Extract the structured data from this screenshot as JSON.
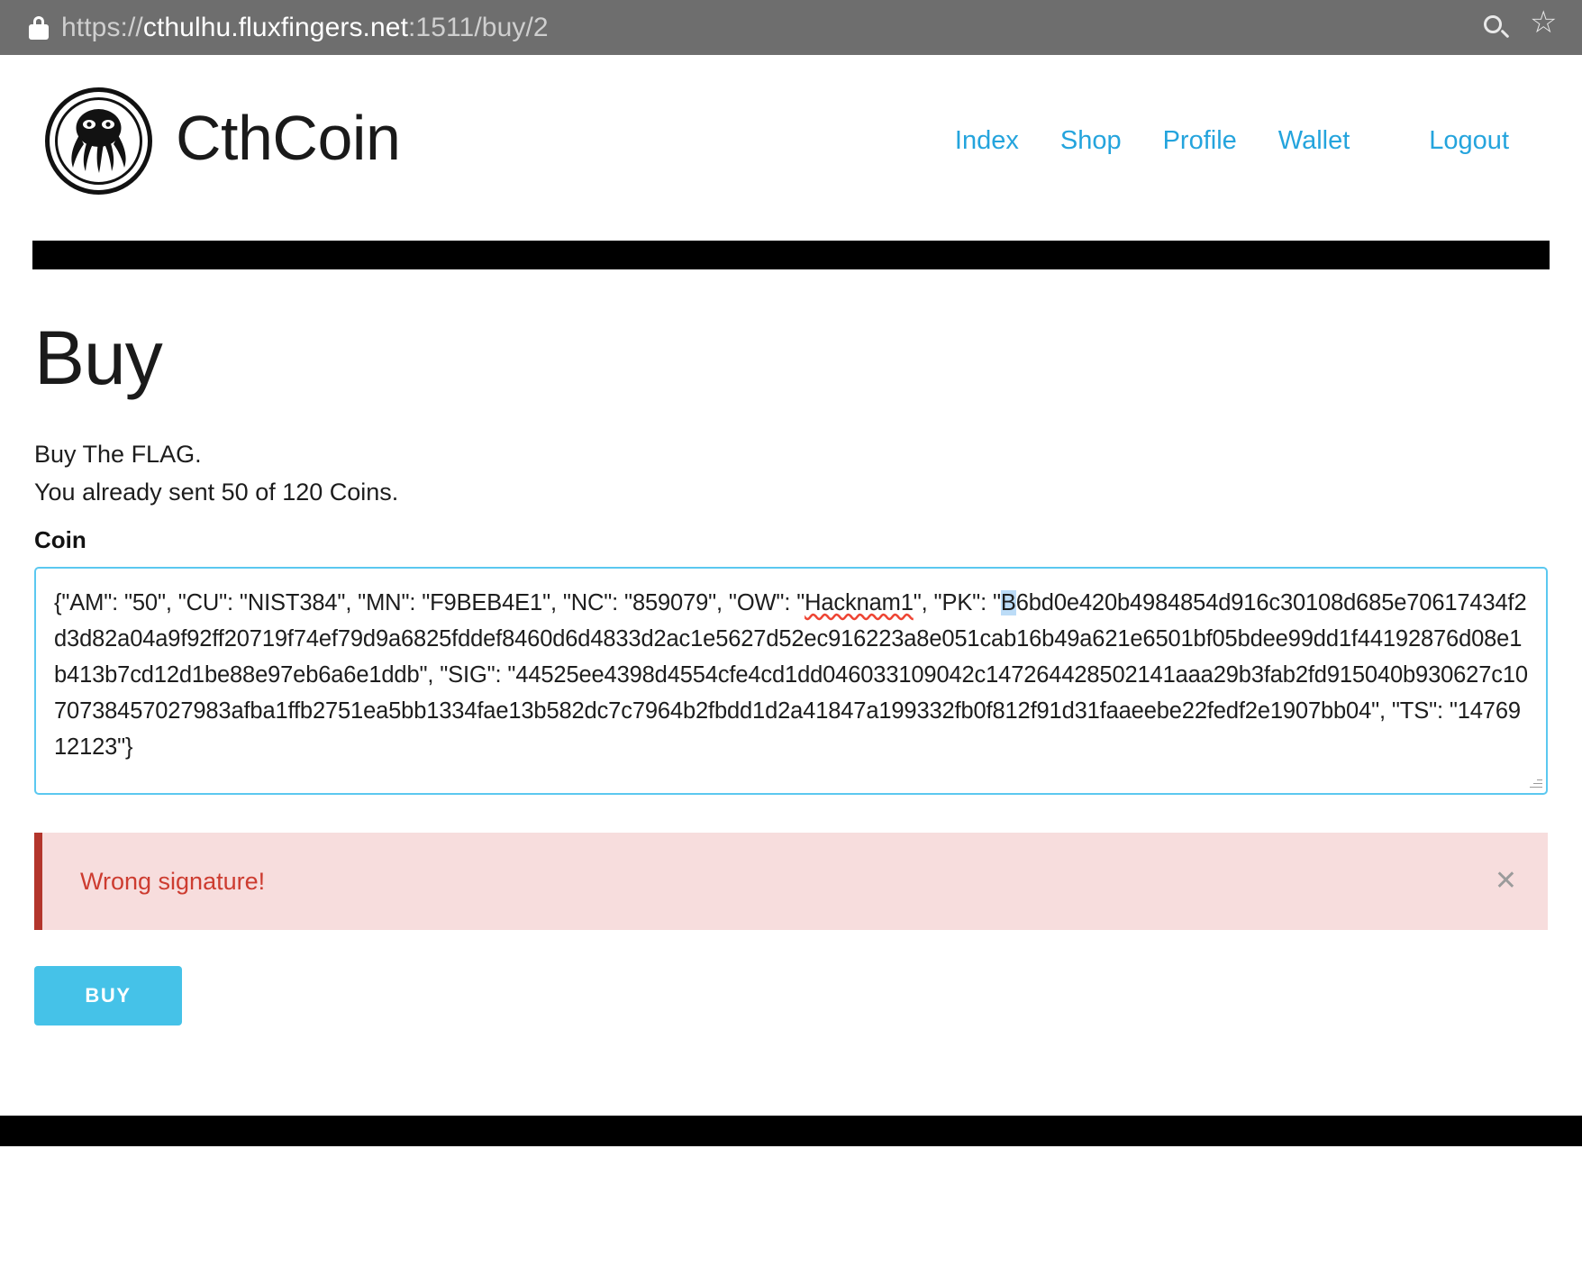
{
  "browser": {
    "lock_icon": "lock-icon",
    "url_prefix": "https://",
    "url_host": "cthulhu.fluxfingers.net",
    "url_suffix": ":1511/buy/2",
    "search_icon": "search-icon",
    "bookmark_icon": "star-icon"
  },
  "site": {
    "brand": "CthCoin",
    "logo_icon": "cthulhu-logo-icon",
    "nav": [
      {
        "label": "Index"
      },
      {
        "label": "Shop"
      },
      {
        "label": "Profile"
      },
      {
        "label": "Wallet"
      },
      {
        "label": "Logout"
      }
    ]
  },
  "main": {
    "title": "Buy",
    "description": "Buy The FLAG.",
    "status": "You already sent 50 of 120 Coins.",
    "field_label": "Coin",
    "coin_value_part1": "{\"AM\": \"50\", \"CU\": \"NIST384\", \"MN\": \"F9BEB4E1\", \"NC\": \"859079\", \"OW\": \"",
    "coin_owner": "Hacknam1",
    "coin_value_part2": "\", \"PK\": \"",
    "coin_selected_char": "B",
    "coin_value_part3": "6bd0e420b4984854d916c30108d685e70617434f2d3d82a04a9f92ff20719f74ef79d9a6825fddef8460d6d4833d2ac1e5627d52ec916223a8e051cab16b49a621e6501bf05bdee99dd1f44192876d08e1b413b7cd12d1be88e97eb6a6e1ddb\", \"SIG\": \"44525ee4398d4554cfe4cd1dd046033109042c147264428502141aaa29b3fab2fd915040b930627c1070738457027983afba1ffb2751ea5bb1334fae13b582dc7c7964b2fbdd1d2a41847a199332fb0f812f91d31faaeebe22fedf2e1907bb04\", \"TS\": \"1476912123\"}",
    "alert_message": "Wrong signature!",
    "alert_close_icon": "close-icon",
    "submit_label": "BUY"
  },
  "colors": {
    "accent": "#45c2e8",
    "link": "#24a4dd",
    "alert_text": "#cd3c30",
    "alert_bg": "#f7dddd",
    "alert_border": "#b3352c"
  }
}
